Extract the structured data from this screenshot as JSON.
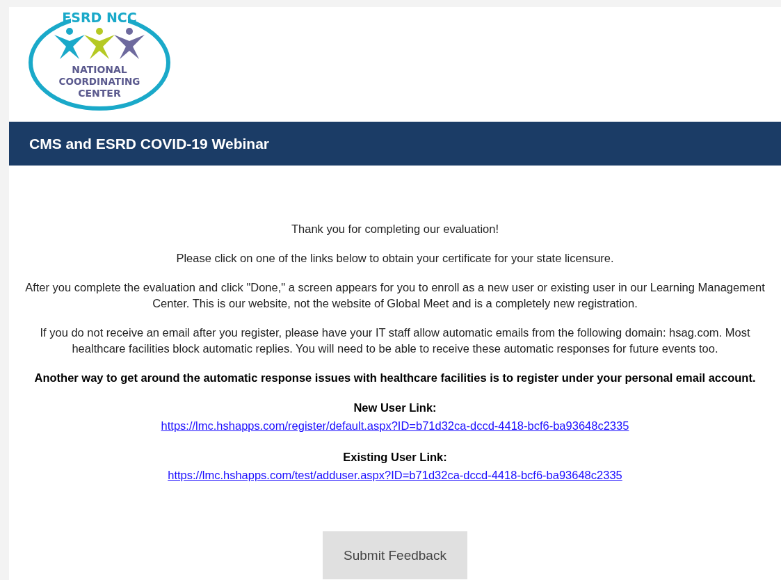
{
  "logo": {
    "top_text": "ESRD NCC",
    "lines": [
      "NATIONAL",
      "COORDINATING",
      "CENTER"
    ]
  },
  "banner": {
    "title": "CMS and ESRD COVID-19 Webinar"
  },
  "paragraphs": [
    {
      "text": "Thank you for completing our evaluation!",
      "bold": false
    },
    {
      "text": "Please click on one of the links below to obtain your certificate for your state licensure.",
      "bold": false
    },
    {
      "text": "After you complete the evaluation and click \"Done,\" a screen appears for you to enroll as a new user or existing user in our Learning Management Center. This is our website, not the website of Global Meet and is a completely new registration.",
      "bold": false
    },
    {
      "text": "If you do not receive an email after you register, please have your IT staff allow automatic emails from the following domain: hsag.com. Most healthcare facilities block automatic replies. You will need to be able to receive these automatic responses for future events too.",
      "bold": false
    },
    {
      "text": "Another way to get around the automatic response issues with healthcare facilities is to register under your personal email account.",
      "bold": true
    }
  ],
  "links": [
    {
      "label": "New User Link:",
      "url": "https://lmc.hshapps.com/register/default.aspx?ID=b71d32ca-dccd-4418-bcf6-ba93648c2335"
    },
    {
      "label": "Existing User Link:",
      "url": "https://lmc.hshapps.com/test/adduser.aspx?ID=b71d32ca-dccd-4418-bcf6-ba93648c2335"
    }
  ],
  "button": {
    "label": "Submit Feedback"
  }
}
